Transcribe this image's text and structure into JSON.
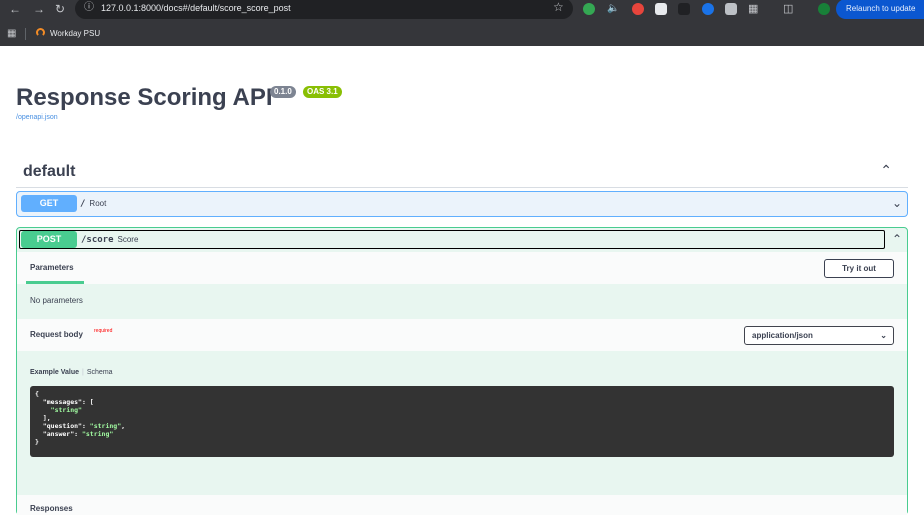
{
  "browser": {
    "url": "127.0.0.1:8000/docs#/default/score_score_post",
    "relaunch_label": "Relaunch to update",
    "bookmarks": [
      {
        "label": "Workday PSU"
      }
    ]
  },
  "api": {
    "title": "Response Scoring API",
    "version_badge": "0.1.0",
    "oas_badge": "OAS 3.1",
    "spec_link": "/openapi.json"
  },
  "tag": {
    "name": "default"
  },
  "operations": [
    {
      "method": "GET",
      "path": "/",
      "summary": "Root"
    },
    {
      "method": "POST",
      "path": "/score",
      "summary": "Score"
    }
  ],
  "post_details": {
    "parameters_tab": "Parameters",
    "try_it_out": "Try it out",
    "no_parameters": "No parameters",
    "request_body_label": "Request body",
    "required_label": "required",
    "content_type": "application/json",
    "example_value_tab": "Example Value",
    "schema_tab": "Schema",
    "example_body": "{\n  \"messages\": [\n    \"string\"\n  ],\n  \"question\": \"string\",\n  \"answer\": \"string\"\n}",
    "responses_label": "Responses"
  },
  "colors": {
    "get": "#61affe",
    "post": "#49cc90",
    "title": "#3b4151",
    "relaunch": "#0b57d0"
  }
}
